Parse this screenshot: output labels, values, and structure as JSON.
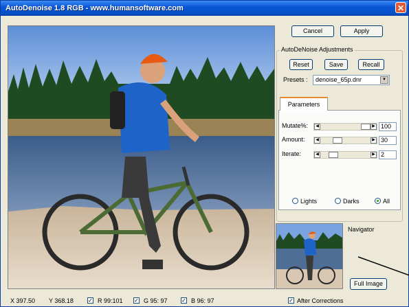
{
  "window": {
    "title": "AutoDenoise 1.8 RGB - www.humansoftware.com",
    "close_glyph": "✕"
  },
  "buttons": {
    "cancel": "Cancel",
    "apply": "Apply",
    "reset": "Reset",
    "save": "Save",
    "recall": "Recall",
    "full_image": "Full Image"
  },
  "adjustments": {
    "group_label": "AutoDeNoise Adjustments",
    "presets_label": "Presets :",
    "preset_value": "denoise_65p.dnr"
  },
  "parameters": {
    "tab_label": "Parameters",
    "rows": [
      {
        "label": "Mutate%:",
        "value": "100",
        "fraction": 1.0
      },
      {
        "label": "Amount:",
        "value": "30",
        "fraction": 0.3
      },
      {
        "label": "Iterate:",
        "value": "2",
        "fraction": 0.2
      }
    ],
    "radios": {
      "lights": "Lights",
      "darks": "Darks",
      "all": "All",
      "selected": "All"
    }
  },
  "navigator": {
    "label": "Navigator"
  },
  "status": {
    "x": "X 397.50",
    "y": "Y 368.18",
    "r": "R  99:101",
    "g": "G  95: 97",
    "b": "B  96: 97",
    "check_r": true,
    "check_g": true,
    "check_b": true
  },
  "after_corrections": {
    "label": "After Corrections",
    "checked": true
  },
  "icons": [
    "close-icon",
    "dropdown-arrow-icon",
    "slider-left-arrow-icon",
    "slider-right-arrow-icon"
  ]
}
